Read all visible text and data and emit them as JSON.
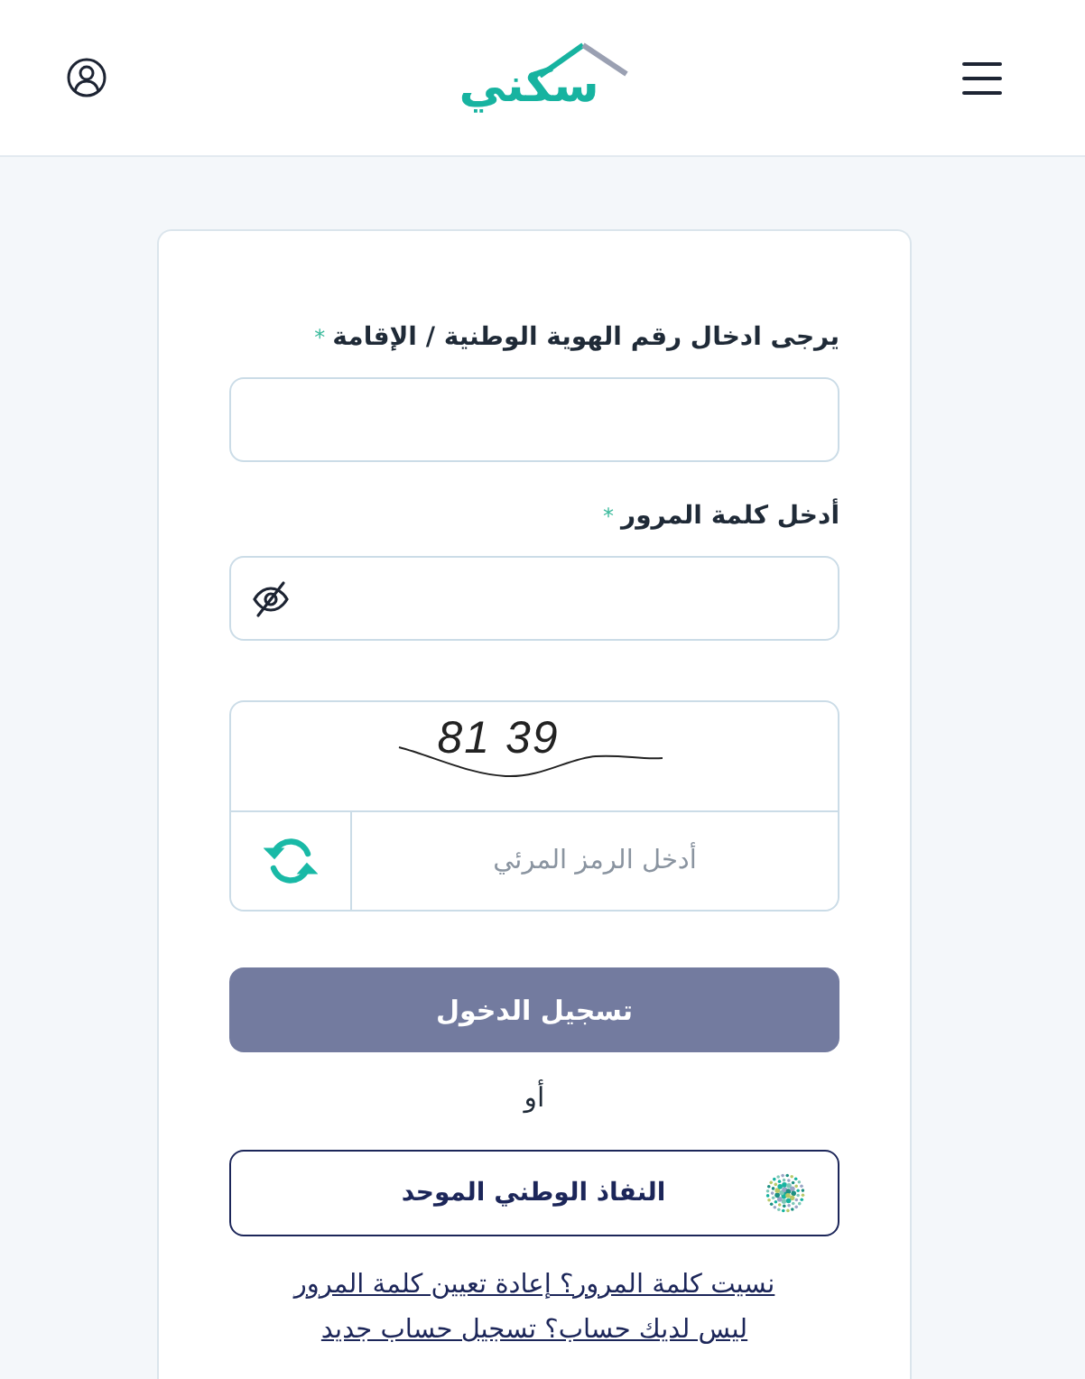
{
  "header": {
    "logo": "سكني"
  },
  "fields": [
    {
      "kind": "text",
      "label": "يرجى ادخال رقم الهوية الوطنية / الإقامة",
      "required_mark": "*"
    },
    {
      "kind": "password",
      "label": "أدخل كلمة المرور",
      "required_mark": "*"
    }
  ],
  "captcha": {
    "code": "81 39",
    "placeholder": "أدخل الرمز المرئي"
  },
  "login_button": {
    "label": "تسجيل الدخول",
    "disabled": true
  },
  "separator": "أو",
  "nafath_button": {
    "label": "النفاذ الوطني الموحد"
  },
  "links": [
    "نسيت كلمة المرور؟ إعادة تعيين كلمة المرور",
    "ليس لديك حساب؟ تسجيل حساب جديد"
  ]
}
